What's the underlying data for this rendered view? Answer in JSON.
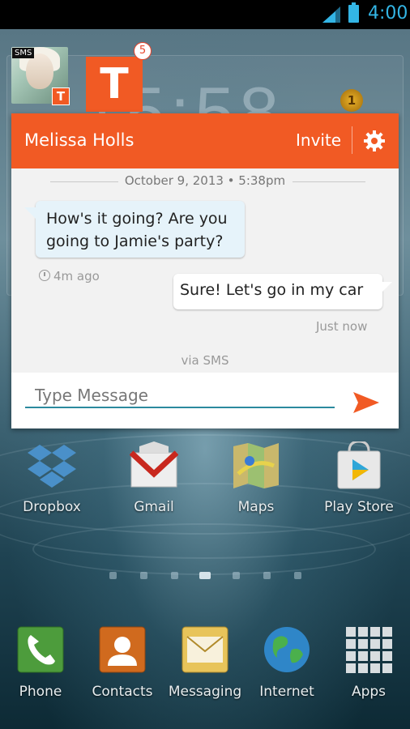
{
  "status_bar": {
    "time": "4:00"
  },
  "background_widget": {
    "clock_text": "15:58",
    "medal_count": "1"
  },
  "chat_heads": {
    "sms_tag": "SMS",
    "app_letter": "T",
    "unread_count": "5"
  },
  "chat": {
    "contact_name": "Melissa Holls",
    "invite_label": "Invite",
    "date_separator": "October 9, 2013  •  5:38pm",
    "messages": [
      {
        "direction": "incoming",
        "text_line1": "How's it going? Are you",
        "text_line2": "going to Jamie's party?",
        "time": "4m ago"
      },
      {
        "direction": "outgoing",
        "text": "Sure! Let's go in my car",
        "time": "Just now"
      }
    ],
    "via": "via SMS",
    "input_placeholder": "Type Message"
  },
  "home_row": [
    {
      "label": "Dropbox",
      "icon": "dropbox-icon"
    },
    {
      "label": "Gmail",
      "icon": "gmail-icon"
    },
    {
      "label": "Maps",
      "icon": "maps-icon"
    },
    {
      "label": "Play Store",
      "icon": "play-store-icon"
    }
  ],
  "dock": [
    {
      "label": "Phone",
      "icon": "phone-icon"
    },
    {
      "label": "Contacts",
      "icon": "contacts-icon"
    },
    {
      "label": "Messaging",
      "icon": "messaging-icon"
    },
    {
      "label": "Internet",
      "icon": "globe-icon"
    },
    {
      "label": "Apps",
      "icon": "apps-grid-icon"
    }
  ],
  "page_indicator": {
    "count": 7,
    "active_index": 3
  },
  "colors": {
    "accent": "#f15a24",
    "status_blue": "#33b5e5",
    "input_line": "#2b8a9e"
  }
}
